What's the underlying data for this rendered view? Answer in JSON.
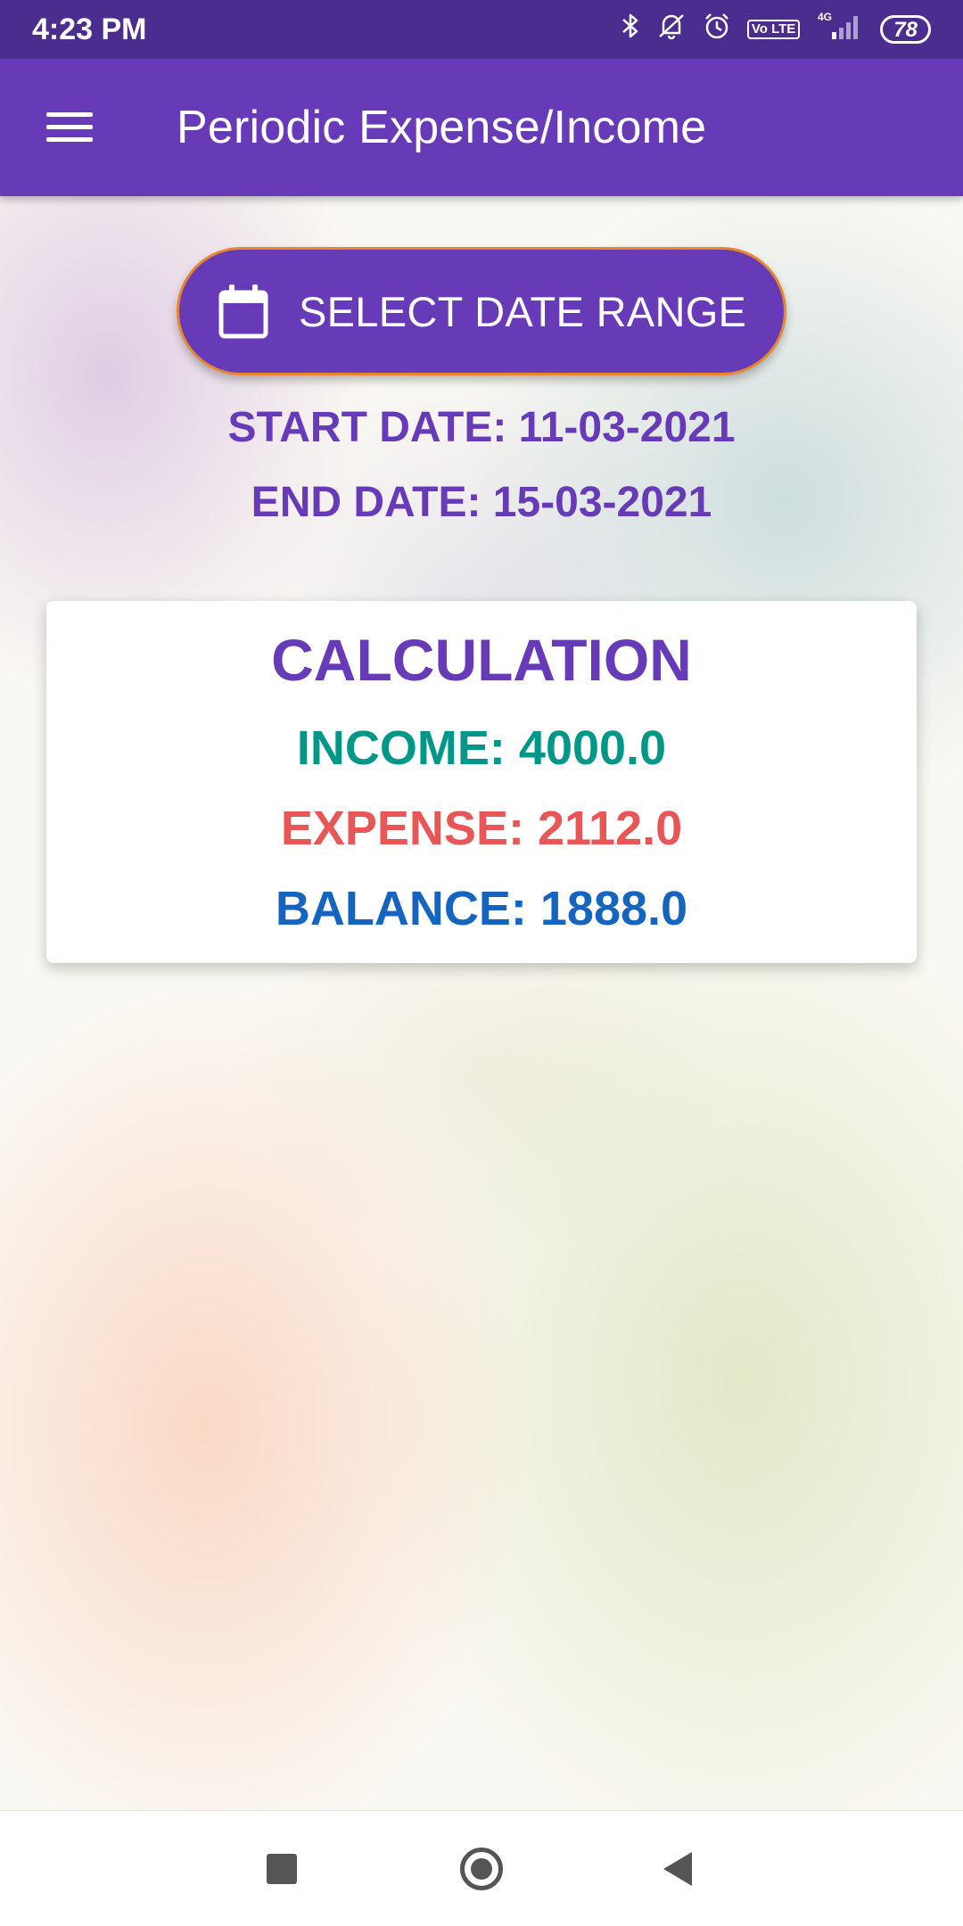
{
  "status_bar": {
    "time": "4:23 PM",
    "network": "4G",
    "volte": "Vo LTE",
    "battery": "78"
  },
  "app_bar": {
    "title": "Periodic Expense/Income"
  },
  "date_range_button": {
    "label": "SELECT DATE RANGE"
  },
  "dates": {
    "start": "START DATE: 11-03-2021",
    "end": "END DATE: 15-03-2021"
  },
  "calculation": {
    "title": "CALCULATION",
    "income": "INCOME: 4000.0",
    "expense": "EXPENSE: 2112.0",
    "balance": "BALANCE: 1888.0"
  },
  "colors": {
    "primary": "#673ab7",
    "status_bar": "#4b2d8f",
    "button_border": "#e8862e",
    "income": "#009688",
    "expense": "#e85656",
    "balance": "#1565c0"
  },
  "icons": {
    "menu": "menu-icon",
    "calendar": "calendar-icon",
    "bluetooth": "bluetooth-icon",
    "silent": "silent-icon",
    "alarm": "alarm-icon",
    "signal": "signal-icon",
    "nav_recents": "recents-icon",
    "nav_home": "home-icon",
    "nav_back": "back-icon"
  }
}
